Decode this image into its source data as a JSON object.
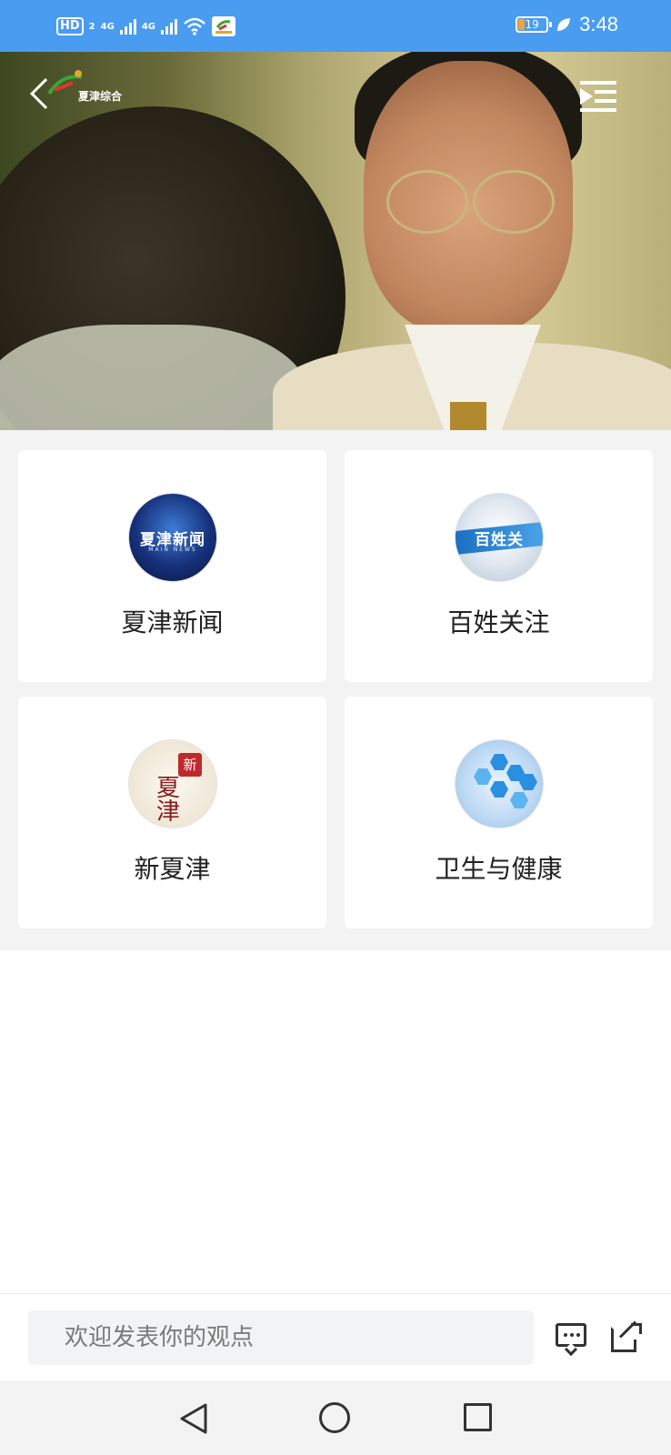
{
  "status_bar": {
    "hd_label": "HD",
    "sim_index": "2",
    "network_1": "4G",
    "network_2": "4G",
    "battery_level": "19",
    "time": "3:48"
  },
  "video": {
    "channel_name": "夏津综合",
    "back_icon": "back-chevron-icon",
    "playlist_icon": "playlist-icon"
  },
  "cards": [
    {
      "label": "夏津新闻",
      "thumb_text": "夏津新闻",
      "thumb_sub": "MAIN NEWS"
    },
    {
      "label": "百姓关注",
      "thumb_text": "百姓关"
    },
    {
      "label": "新夏津",
      "seal_text": "新",
      "brush_text": "夏\n津"
    },
    {
      "label": "卫生与健康"
    }
  ],
  "comment": {
    "placeholder": "欢迎发表你的观点"
  },
  "colors": {
    "status_bar": "#4a9cf0",
    "page_bg": "#f3f3f3",
    "card_bg": "#ffffff",
    "text": "#222222"
  },
  "nav": {
    "back": "back-triangle-icon",
    "home": "home-circle-icon",
    "recent": "recents-square-icon"
  }
}
